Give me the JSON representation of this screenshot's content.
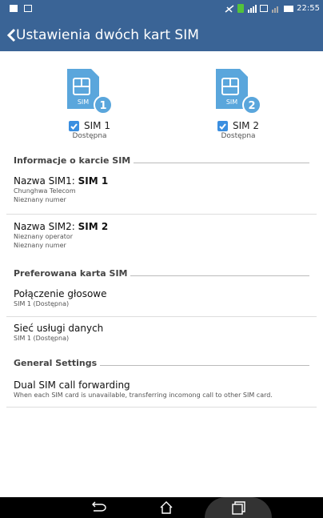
{
  "status_bar": {
    "time": "22:55"
  },
  "action_bar": {
    "title": "Ustawienia dwóch kart SIM"
  },
  "sims": [
    {
      "badge": "1",
      "card_label": "SIM",
      "name": "SIM 1",
      "status": "Dostępna",
      "checked": true
    },
    {
      "badge": "2",
      "card_label": "SIM",
      "name": "SIM 2",
      "status": "Dostępna",
      "checked": true
    }
  ],
  "sections": {
    "info": "Informacje o karcie SIM",
    "preferred": "Preferowana karta SIM",
    "general": "General Settings"
  },
  "info_items": [
    {
      "prefix": "Nazwa SIM1: ",
      "bold": "SIM 1",
      "line1": "Chunghwa Telecom",
      "line2": "Nieznany numer"
    },
    {
      "prefix": "Nazwa SIM2: ",
      "bold": "SIM 2",
      "line1": "Nieznany operator",
      "line2": "Nieznany numer"
    }
  ],
  "preferred_items": [
    {
      "title": "Połączenie głosowe",
      "subtitle": "SIM 1 (Dostępna)"
    },
    {
      "title": "Sieć usługi danych",
      "subtitle": "SIM 1 (Dostępna)"
    }
  ],
  "general_items": [
    {
      "title": "Dual SIM call forwarding",
      "subtitle": "When each SIM card is unavailable, transferring incomong call to other SIM card."
    }
  ],
  "colors": {
    "accent": "#3a6496",
    "sim_icon": "#5aa6dc",
    "checkbox": "#3a8ee0"
  },
  "nav_icons": [
    "back-icon",
    "home-icon",
    "recent-apps-icon"
  ]
}
